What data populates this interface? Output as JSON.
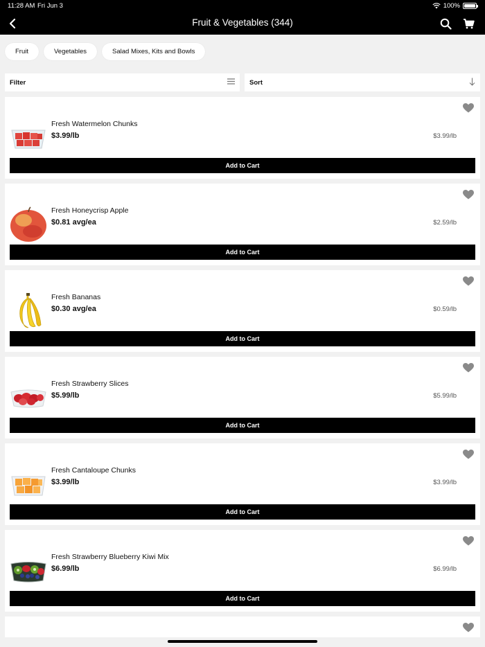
{
  "status": {
    "time": "11:28 AM",
    "date": "Fri Jun 3",
    "battery": "100%",
    "battery_level": 1.0
  },
  "header": {
    "title": "Fruit & Vegetables (344)"
  },
  "chips": [
    "Fruit",
    "Vegetables",
    "Salad Mixes, Kits and Bowls"
  ],
  "controls": {
    "filter": "Filter",
    "sort": "Sort"
  },
  "add_to_cart_label": "Add to Cart",
  "products": [
    {
      "name": "Fresh Watermelon Chunks",
      "price": "$3.99/lb",
      "unit_price": "$3.99/lb",
      "icon": "watermelon-chunks-icon"
    },
    {
      "name": "Fresh Honeycrisp Apple",
      "price": "$0.81 avg/ea",
      "unit_price": "$2.59/lb",
      "icon": "apple-icon"
    },
    {
      "name": "Fresh Bananas",
      "price": "$0.30 avg/ea",
      "unit_price": "$0.59/lb",
      "icon": "banana-icon"
    },
    {
      "name": "Fresh Strawberry Slices",
      "price": "$5.99/lb",
      "unit_price": "$5.99/lb",
      "icon": "strawberry-slices-icon"
    },
    {
      "name": "Fresh Cantaloupe Chunks",
      "price": "$3.99/lb",
      "unit_price": "$3.99/lb",
      "icon": "cantaloupe-chunks-icon"
    },
    {
      "name": "Fresh Strawberry Blueberry Kiwi Mix",
      "price": "$6.99/lb",
      "unit_price": "$6.99/lb",
      "icon": "fruit-mix-icon"
    }
  ],
  "colors": {
    "header_bg": "#000000",
    "button_bg": "#000000",
    "page_bg": "#f1f1f1",
    "heart": "#8a8a8a"
  }
}
